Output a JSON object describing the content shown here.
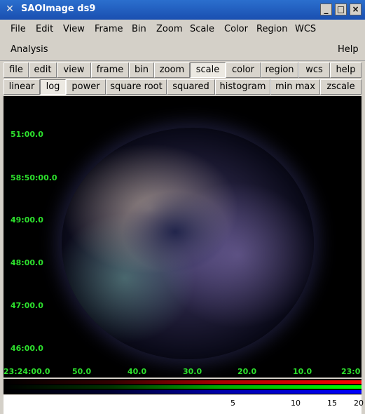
{
  "window": {
    "title": "SAOImage ds9",
    "app_icon": "x-logo-icon",
    "controls": [
      "minimize-icon",
      "maximize-icon",
      "close-icon"
    ]
  },
  "menubar": {
    "items": [
      "File",
      "Edit",
      "View",
      "Frame",
      "Bin",
      "Zoom",
      "Scale",
      "Color",
      "Region",
      "WCS"
    ],
    "items_row2": [
      "Analysis"
    ],
    "help": "Help"
  },
  "buttonbar": [
    "file",
    "edit",
    "view",
    "frame",
    "bin",
    "zoom",
    "scale",
    "color",
    "region",
    "wcs",
    "help"
  ],
  "scale_buttons": [
    "linear",
    "log",
    "power",
    "square root",
    "squared",
    "histogram",
    "min max",
    "zscale"
  ],
  "selected": {
    "buttonbar": "scale",
    "scale": "log"
  },
  "image": {
    "y_labels": [
      "51:00.0",
      "58:50:00.0",
      "49:00.0",
      "48:00.0",
      "47:00.0",
      "46:00.0"
    ],
    "x_labels": [
      "23:24:00.0",
      "50.0",
      "40.0",
      "30.0",
      "20.0",
      "10.0",
      "23:0"
    ],
    "label_color": "#2de02d"
  },
  "colorbar": {
    "ticks": [
      "5",
      "10",
      "15",
      "20"
    ],
    "colors": [
      "#ff0000",
      "#00ff00",
      "#0000ff"
    ]
  }
}
